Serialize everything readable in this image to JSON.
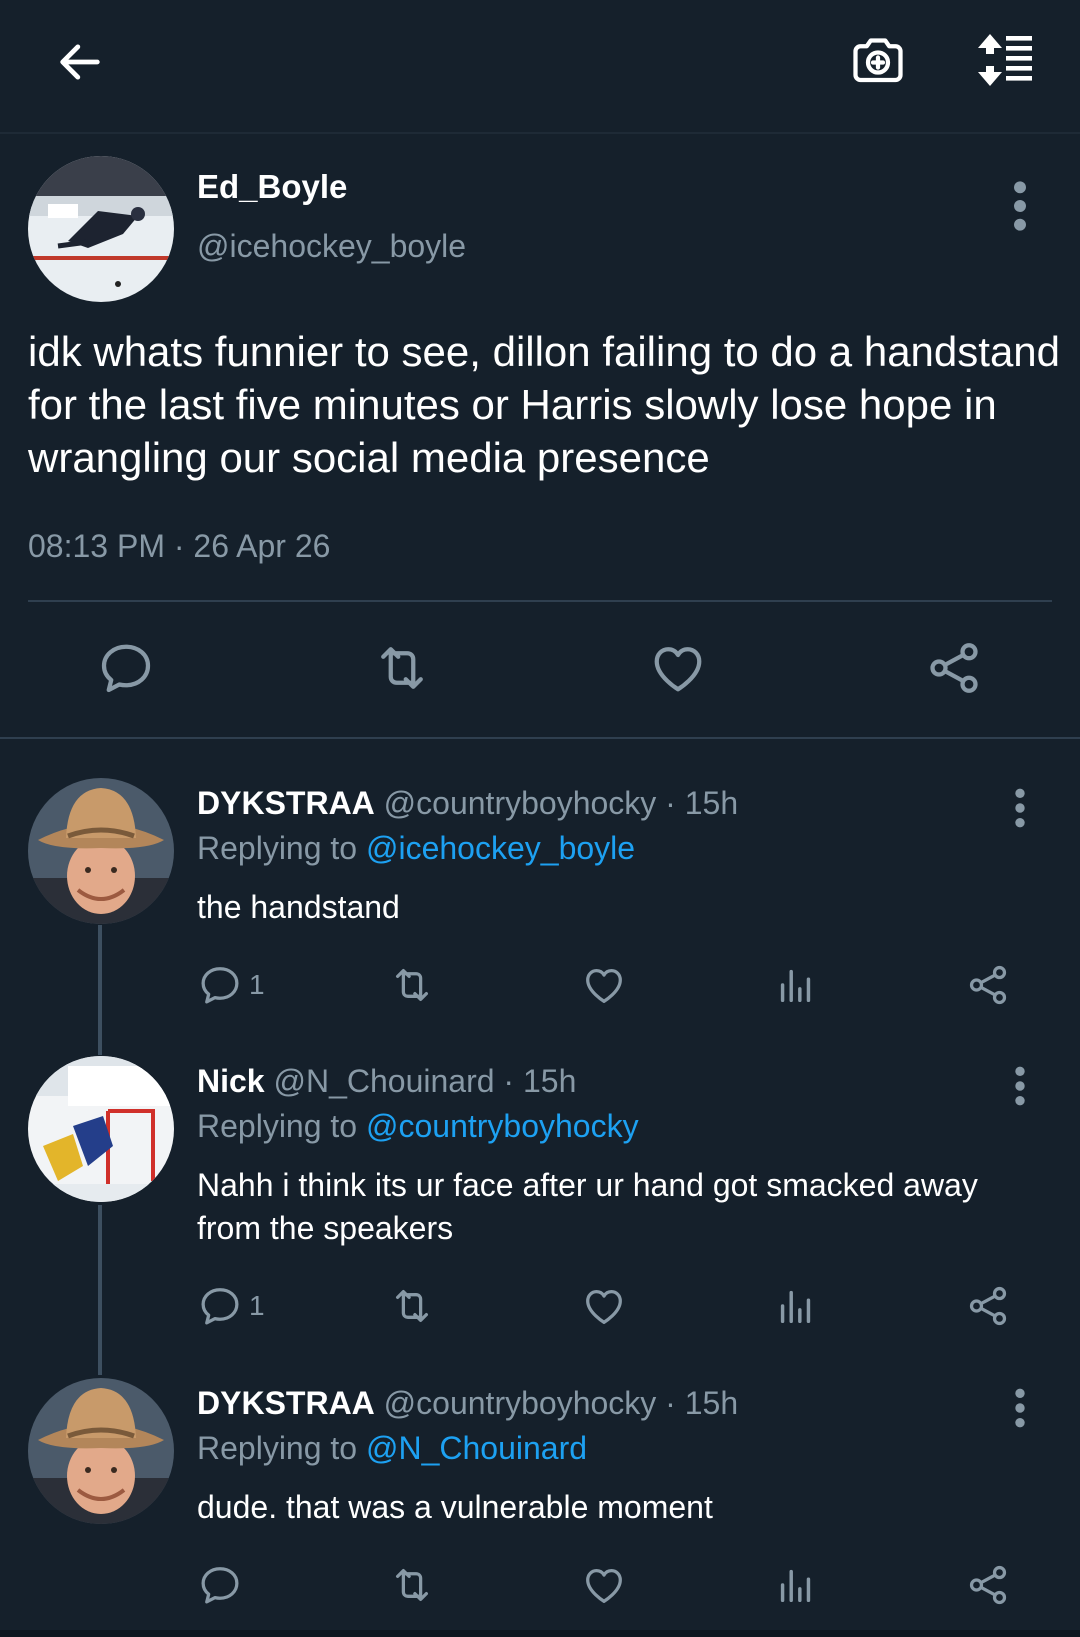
{
  "colors": {
    "background": "#15202b",
    "muted": "#8899a6",
    "accent": "#1da1f2",
    "divider": "#2f3f4f"
  },
  "topbar": {
    "back_icon": "arrow-left-icon",
    "camera_icon": "camera-plus-icon",
    "sort_icon": "sort-list-icon"
  },
  "tweet": {
    "display_name": "Ed_Boyle",
    "handle": "@icehockey_boyle",
    "text": "idk whats funnier to see, dillon failing to do a handstand for the last five minutes or Harris slowly lose hope in wrangling our social media presence",
    "timestamp": "08:13 PM · 26 Apr 26"
  },
  "replies": [
    {
      "display_name": "DYKSTRAA",
      "meta": "@countryboyhocky · 15h",
      "replying_prefix": "Replying to",
      "replying_to": "@icehockey_boyle",
      "text": "the handstand",
      "reply_count": "1"
    },
    {
      "display_name": "Nick",
      "meta": "@N_Chouinard · 15h",
      "replying_prefix": "Replying to",
      "replying_to": "@countryboyhocky",
      "text": "Nahh i think its ur face after ur hand got smacked away from the speakers",
      "reply_count": "1"
    },
    {
      "display_name": "DYKSTRAA",
      "meta": "@countryboyhocky · 15h",
      "replying_prefix": "Replying to",
      "replying_to": "@N_Chouinard",
      "text": "dude. that was a vulnerable moment",
      "reply_count": ""
    }
  ]
}
